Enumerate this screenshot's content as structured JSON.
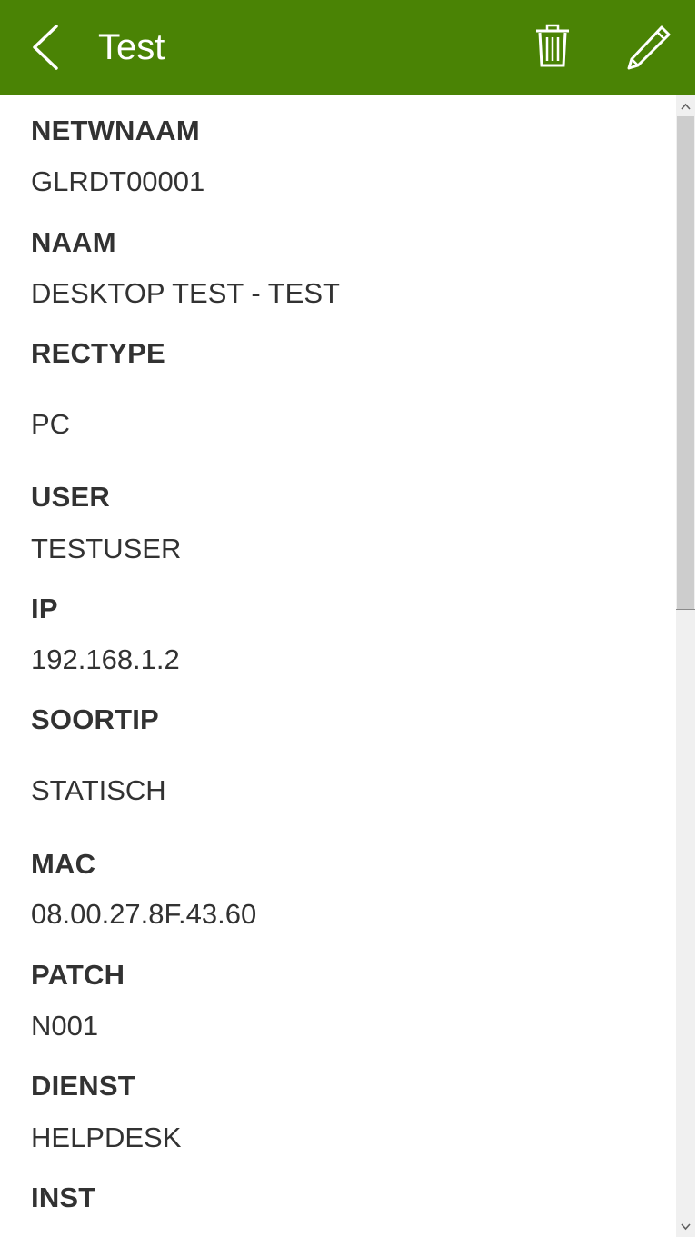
{
  "header": {
    "title": "Test",
    "back_icon": "chevron-left-icon",
    "delete_icon": "trash-icon",
    "edit_icon": "pencil-icon",
    "background_color": "#4a8305"
  },
  "fields": [
    {
      "label": "NETWNAAM",
      "value": "GLRDT00001"
    },
    {
      "label": "NAAM",
      "value": "DESKTOP TEST - TEST"
    },
    {
      "label": "RECTYPE",
      "value": "PC"
    },
    {
      "label": "USER",
      "value": "TESTUSER"
    },
    {
      "label": "IP",
      "value": "192.168.1.2"
    },
    {
      "label": "SOORTIP",
      "value": "STATISCH"
    },
    {
      "label": "MAC",
      "value": "08.00.27.8F.43.60"
    },
    {
      "label": "PATCH",
      "value": "N001"
    },
    {
      "label": "DIENST",
      "value": "HELPDESK"
    },
    {
      "label": "INST",
      "value": ""
    }
  ]
}
